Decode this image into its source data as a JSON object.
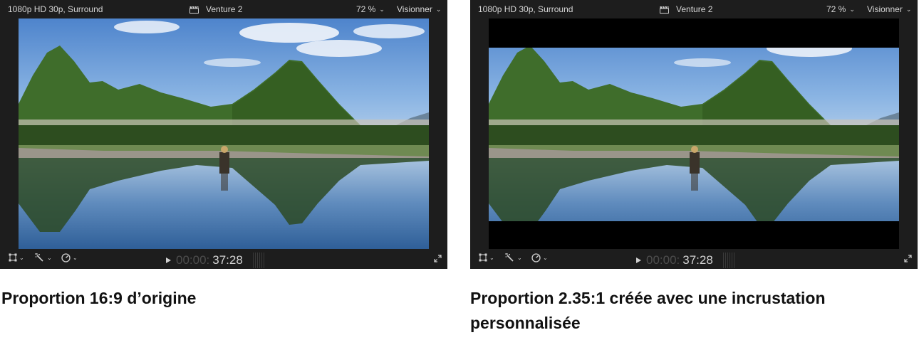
{
  "viewers": {
    "left": {
      "format_label": "1080p HD 30p, Surround",
      "project_title": "Venture 2",
      "zoom_label": "72 %",
      "view_menu_label": "Visionner",
      "timecode_dim": "00:00:",
      "timecode_main": "37:28"
    },
    "right": {
      "format_label": "1080p HD 30p, Surround",
      "project_title": "Venture 2",
      "zoom_label": "72 %",
      "view_menu_label": "Visionner",
      "timecode_dim": "00:00:",
      "timecode_main": "37:28"
    }
  },
  "captions": {
    "left": "Proportion 16:9 d’origine",
    "right": "Proportion 2.35:1 créée avec une incrustation personnalisée"
  },
  "icons": {
    "clapper": "clapperboard-icon",
    "transform": "transform-icon",
    "enhance": "magic-wand-icon",
    "speed": "speedometer-icon",
    "play": "play-icon",
    "fullscreen": "fullscreen-icon"
  },
  "colors": {
    "viewer_bg": "#1d1d1d",
    "letterbox": "#000000",
    "sky": "#5d8fd0",
    "mountain": "#3d6a2a",
    "water": "#3e6796"
  }
}
